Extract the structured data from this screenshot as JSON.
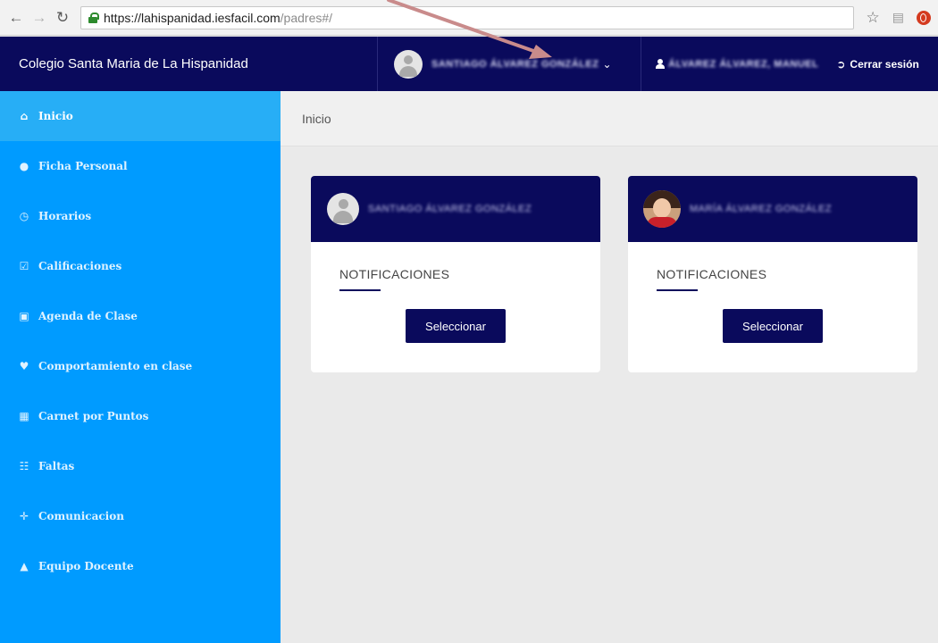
{
  "browser": {
    "url_host": "https://lahispanidad.iesfacil.com",
    "url_path": "/padres#/"
  },
  "app": {
    "brand": "Colegio Santa Maria de La Hispanidad",
    "student_selector_name": "SANTIAGO ÁLVAREZ GONZÁLEZ",
    "user_name": "ÁLVAREZ ÁLVAREZ, MANUEL",
    "logout_label": "Cerrar sesión"
  },
  "sidebar": {
    "items": [
      {
        "label": "Inicio",
        "icon": "home-icon",
        "active": true
      },
      {
        "label": "Ficha Personal",
        "icon": "user-icon"
      },
      {
        "label": "Horarios",
        "icon": "clock-icon"
      },
      {
        "label": "Calificaciones",
        "icon": "check-square-icon"
      },
      {
        "label": "Agenda de Clase",
        "icon": "briefcase-icon"
      },
      {
        "label": "Comportamiento en clase",
        "icon": "heart-icon"
      },
      {
        "label": "Carnet por Puntos",
        "icon": "bar-chart-icon"
      },
      {
        "label": "Faltas",
        "icon": "calendar-icon"
      },
      {
        "label": "Comunicacion",
        "icon": "pin-icon"
      },
      {
        "label": "Equipo Docente",
        "icon": "graduation-cap-icon"
      }
    ]
  },
  "main": {
    "breadcrumb": "Inicio",
    "cards": [
      {
        "name": "SANTIAGO ÁLVAREZ GONZÁLEZ",
        "notifications_label": "NOTIFICACIONES",
        "button_label": "Seleccionar",
        "avatar": "default-avatar"
      },
      {
        "name": "MARÍA ÁLVAREZ GONZÁLEZ",
        "notifications_label": "NOTIFICACIONES",
        "button_label": "Seleccionar",
        "avatar": "photo-avatar"
      }
    ]
  },
  "colors": {
    "navy": "#0a0a5c",
    "sidebar_blue": "#009bff",
    "sidebar_active": "#27aef6",
    "annotation_arrow": "#c98b8b"
  }
}
